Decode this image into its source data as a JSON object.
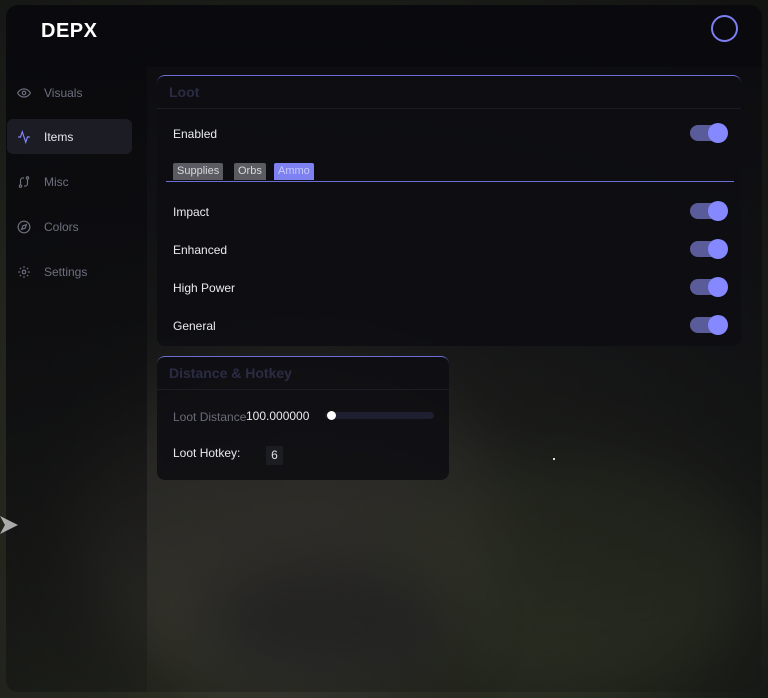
{
  "app": {
    "logo": "DEPX"
  },
  "sidebar": {
    "items": [
      {
        "label": "Visuals",
        "icon": "eye-icon",
        "active": false
      },
      {
        "label": "Items",
        "icon": "activity-icon",
        "active": true
      },
      {
        "label": "Misc",
        "icon": "route-icon",
        "active": false
      },
      {
        "label": "Colors",
        "icon": "compass-icon",
        "active": false
      },
      {
        "label": "Settings",
        "icon": "gear-icon",
        "active": false
      }
    ]
  },
  "loot": {
    "title": "Loot",
    "enabled_label": "Enabled",
    "enabled_on": true,
    "tabs": [
      {
        "label": "Supplies",
        "active": false
      },
      {
        "label": "Orbs",
        "active": false
      },
      {
        "label": "Ammo",
        "active": true
      }
    ],
    "options": [
      {
        "label": "Impact",
        "on": true
      },
      {
        "label": "Enhanced",
        "on": true
      },
      {
        "label": "High Power",
        "on": true
      },
      {
        "label": "General",
        "on": true
      }
    ]
  },
  "distance": {
    "title": "Distance & Hotkey",
    "loot_distance_label": "Loot Distance",
    "loot_distance_value": "100.000000",
    "loot_distance_fraction": 0.02,
    "loot_hotkey_label": "Loot Hotkey:",
    "loot_hotkey_value": "6"
  },
  "colors": {
    "accent": "#8588ff",
    "accent_dark": "#5a5c9a",
    "panel_border": "#6c6fd8"
  }
}
